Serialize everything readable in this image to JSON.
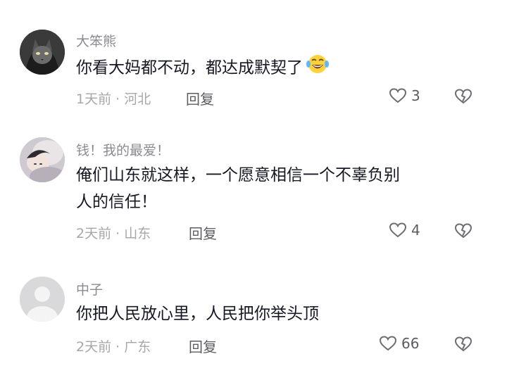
{
  "comments": [
    {
      "username": "大笨熊",
      "text": "你看大妈都不动，都达成默契了",
      "emoji": "😂",
      "time_location": "1天前 · 河北",
      "reply_label": "回复",
      "like_count": "3",
      "avatar": "cat-hoodie-avatar"
    },
    {
      "username": "钱！我的最爱！",
      "text_line1": "俺们山东就这样，一个愿意相信一个不辜负别",
      "text_line2": "人的信任！",
      "time_location": "2天前 · 山东",
      "reply_label": "回复",
      "like_count": "4",
      "avatar": "girl-photo-avatar"
    },
    {
      "username": "中子",
      "text": "你把人民放心里，人民把你举头顶",
      "time_location": "2天前 · 广东",
      "reply_label": "回复",
      "like_count": "66",
      "avatar": "default-avatar"
    }
  ]
}
